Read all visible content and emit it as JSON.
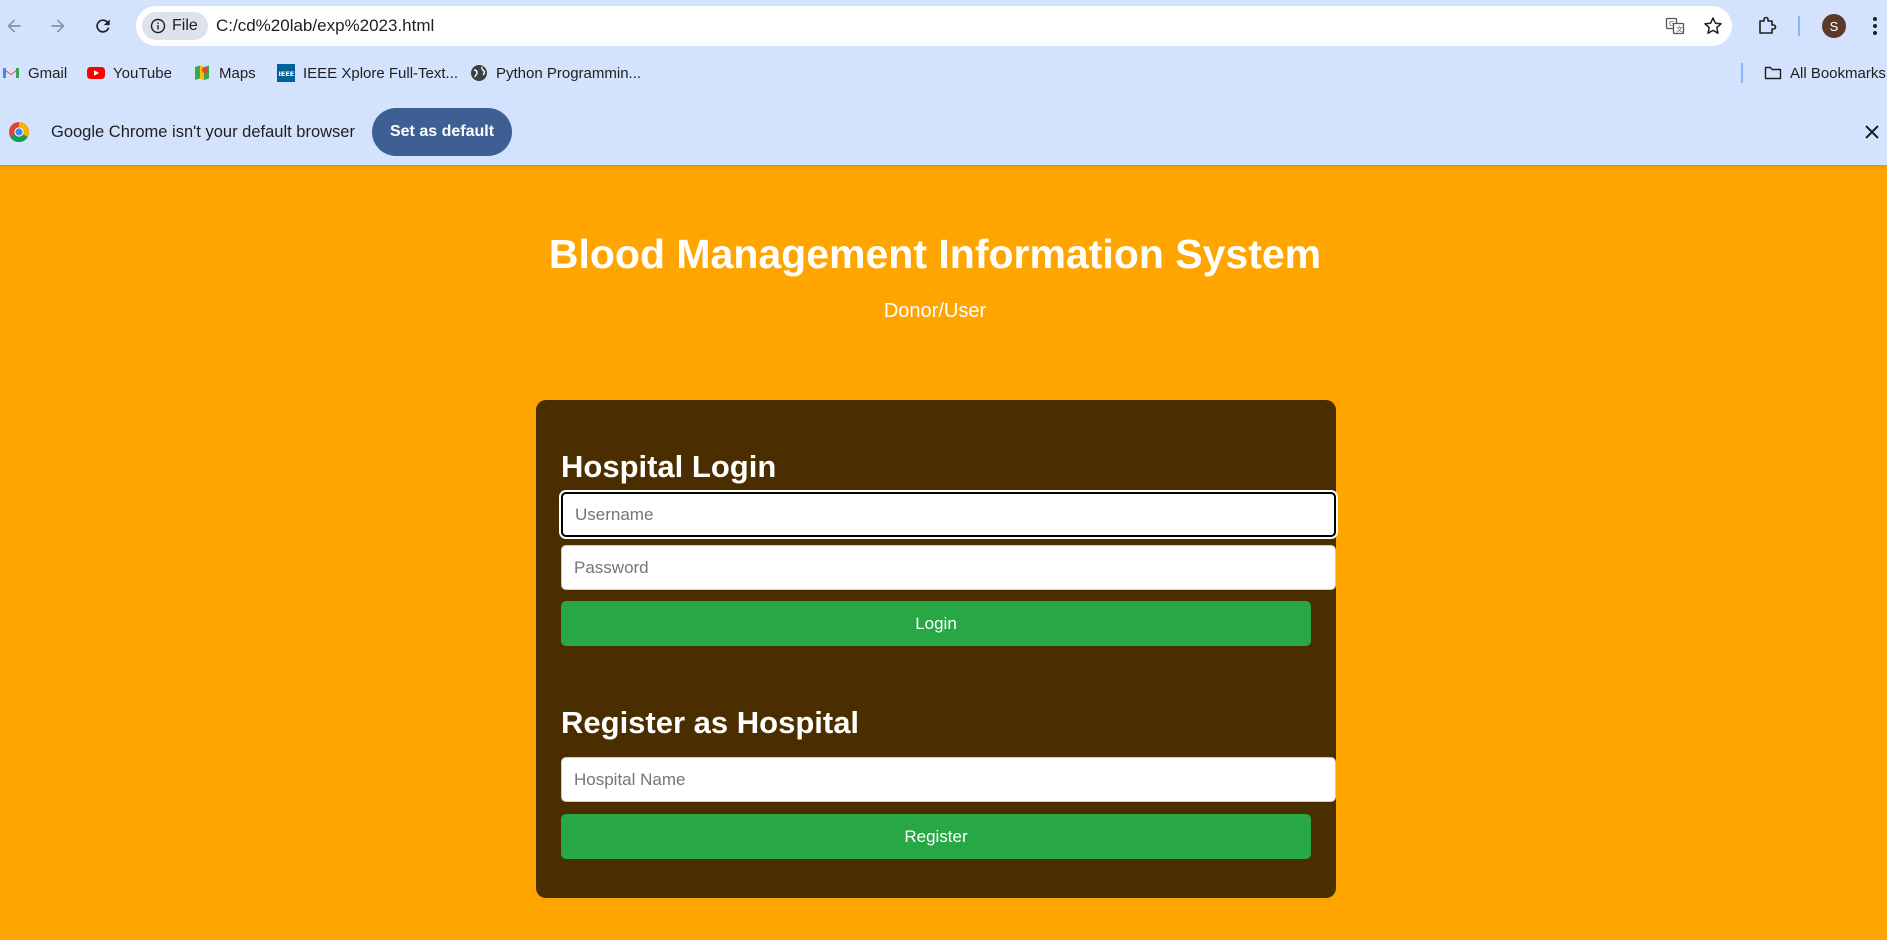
{
  "browser": {
    "site_chip_label": "File",
    "url": "C:/cd%20lab/exp%2023.html",
    "avatar_letter": "S",
    "bookmarks": [
      {
        "label": "Gmail",
        "icon": "gmail-icon"
      },
      {
        "label": "YouTube",
        "icon": "youtube-icon"
      },
      {
        "label": "Maps",
        "icon": "maps-icon"
      },
      {
        "label": "IEEE Xplore Full-Text...",
        "icon": "ieee-icon"
      },
      {
        "label": "Python Programmin...",
        "icon": "globe-icon"
      }
    ],
    "all_bookmarks_label": "All Bookmarks",
    "infobar": {
      "message": "Google Chrome isn't your default browser",
      "button_label": "Set as default"
    }
  },
  "page": {
    "title": "Blood Management Information System",
    "subtitle": "Donor/User",
    "login": {
      "heading": "Hospital Login",
      "username_placeholder": "Username",
      "password_placeholder": "Password",
      "button_label": "Login"
    },
    "register": {
      "heading": "Register as Hospital",
      "name_placeholder": "Hospital Name",
      "button_label": "Register"
    }
  },
  "colors": {
    "page_background": "#ffa500",
    "card_background": "#4a2e00",
    "button_green": "#28a745",
    "chrome_background": "#d3e3fd",
    "set_default_button": "#3d5f94"
  }
}
